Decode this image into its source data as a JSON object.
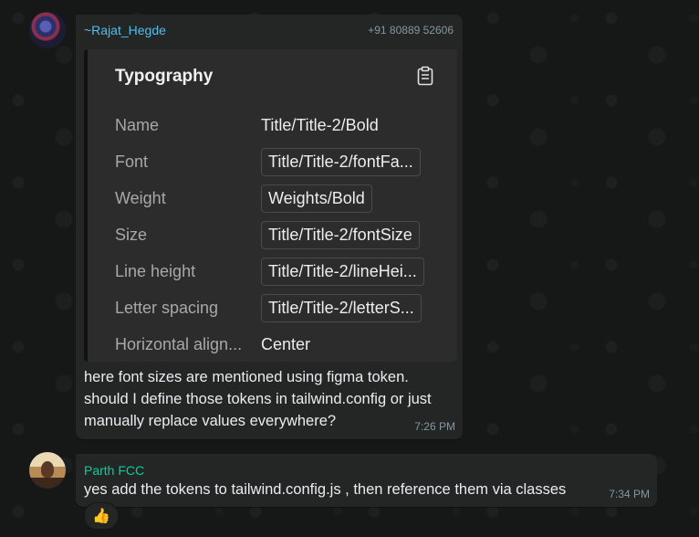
{
  "messages": [
    {
      "sender": "~Rajat_Hegde",
      "phone": "+91 80889 52606",
      "card": {
        "title": "Typography",
        "rows": [
          {
            "label": "Name",
            "value": "Title/Title-2/Bold"
          },
          {
            "label": "Font",
            "value": "Title/Title-2/fontFa..."
          },
          {
            "label": "Weight",
            "value": "Weights/Bold"
          },
          {
            "label": "Size",
            "value": "Title/Title-2/fontSize"
          },
          {
            "label": "Line height",
            "value": "Title/Title-2/lineHei..."
          },
          {
            "label": "Letter spacing",
            "value": "Title/Title-2/letterS..."
          },
          {
            "label": "Horizontal align...",
            "value": "Center"
          }
        ]
      },
      "text": "here font sizes are mentioned using figma token. should I define those tokens in tailwind.config or just manually replace values everywhere?",
      "time": "7:26 PM"
    },
    {
      "sender": "Parth FCC",
      "text": "yes add the tokens to tailwind.config.js , then reference them via classes",
      "time": "7:34 PM",
      "reaction": "👍"
    }
  ]
}
